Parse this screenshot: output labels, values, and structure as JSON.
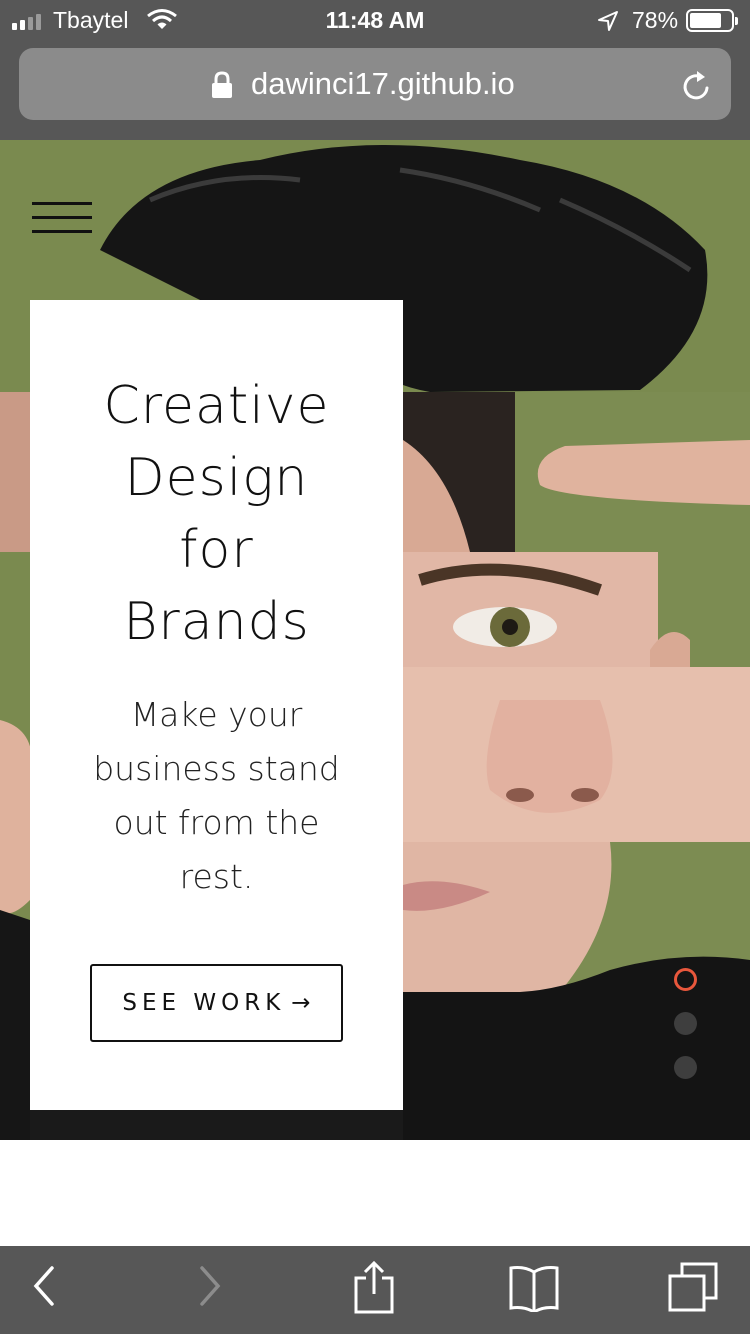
{
  "status_bar": {
    "carrier": "Tbaytel",
    "time": "11:48 AM",
    "battery_percent": "78%",
    "battery_level": 0.78,
    "signal_bars": 2
  },
  "browser": {
    "url": "dawinci17.github.io",
    "icons": [
      "lock-icon",
      "reload-icon",
      "back-icon",
      "forward-icon",
      "share-icon",
      "bookmarks-icon",
      "tabs-icon"
    ]
  },
  "hero": {
    "headline_lines": [
      "Creative",
      "Design",
      "for",
      "Brands"
    ],
    "subtext": "Make your business stand out from the rest.",
    "cta_label": "SEE WORK",
    "cta_arrow": "→",
    "slides": 3,
    "active_slide": 1
  },
  "colors": {
    "chrome": "#575757",
    "background": "#7a8a4f",
    "accent": "#e8573c"
  }
}
